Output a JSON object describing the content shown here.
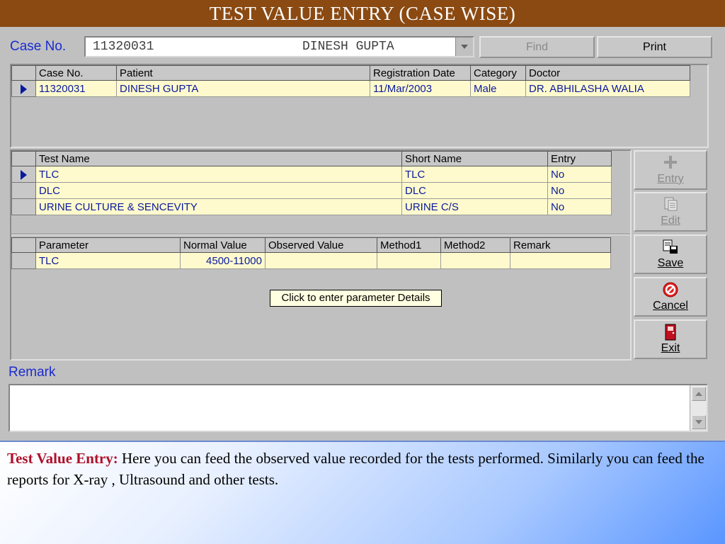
{
  "window": {
    "title": "TEST VALUE ENTRY (CASE WISE)"
  },
  "case_selector": {
    "label": "Case No.",
    "case_number": "11320031",
    "patient_name": "DINESH GUPTA",
    "find_button": "Find",
    "print_button": "Print"
  },
  "case_grid": {
    "columns": [
      "Case No.",
      "Patient",
      "Registration Date",
      "Category",
      "Doctor"
    ],
    "rows": [
      [
        "11320031",
        "DINESH GUPTA",
        "11/Mar/2003",
        "Male",
        "DR. ABHILASHA  WALIA"
      ]
    ]
  },
  "test_grid": {
    "columns": [
      "Test Name",
      "Short Name",
      "Entry"
    ],
    "rows": [
      [
        "TLC",
        "TLC",
        "No"
      ],
      [
        "DLC",
        "DLC",
        "No"
      ],
      [
        "URINE CULTURE & SENCEVITY",
        "URINE C/S",
        "No"
      ]
    ]
  },
  "param_grid": {
    "columns": [
      "Parameter",
      "Normal Value",
      "Observed Value",
      "Method1",
      "Method2",
      "Remark"
    ],
    "rows": [
      [
        "TLC",
        "4500-11000",
        "",
        "",
        "",
        ""
      ]
    ]
  },
  "tooltip": "Click to enter parameter Details",
  "side_buttons": {
    "entry": "Entry",
    "edit": "Edit",
    "save": "Save",
    "cancel": "Cancel",
    "exit": "Exit"
  },
  "remark": {
    "label": "Remark",
    "value": ""
  },
  "description": {
    "heading": "Test  Value Entry:",
    "text": " Here you can feed the observed value recorded for the tests performed. Similarly you can feed the reports for X-ray , Ultrasound and other tests."
  },
  "colors": {
    "title_bar": "#8a4a12",
    "label_blue": "#1a2bd0",
    "row_fill": "#fffacd",
    "highlight": "#b0102a"
  }
}
